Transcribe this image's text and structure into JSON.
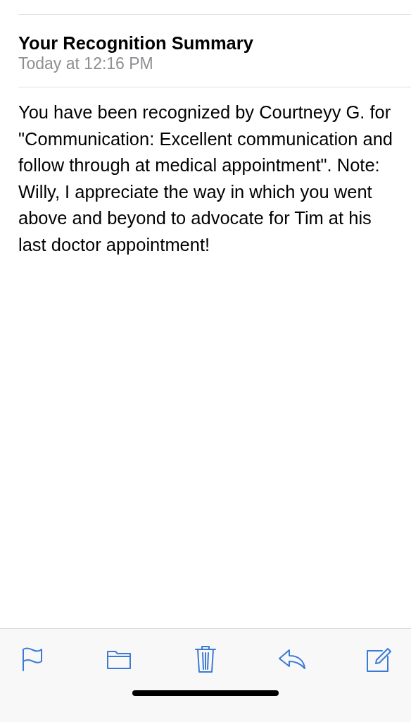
{
  "message": {
    "subject": "Your Recognition Summary",
    "date": "Today at 12:16 PM",
    "body": "You have been recognized by Courtneyy G. for \"Communication: Excellent communication and follow through at medical appointment\". Note: Willy, I appreciate the way in which you went above and beyond to advocate for Tim at his last doctor appointment!"
  },
  "toolbar": [
    {
      "kind": "flag"
    },
    {
      "kind": "folder"
    },
    {
      "kind": "trash"
    },
    {
      "kind": "reply"
    },
    {
      "kind": "compose"
    }
  ]
}
